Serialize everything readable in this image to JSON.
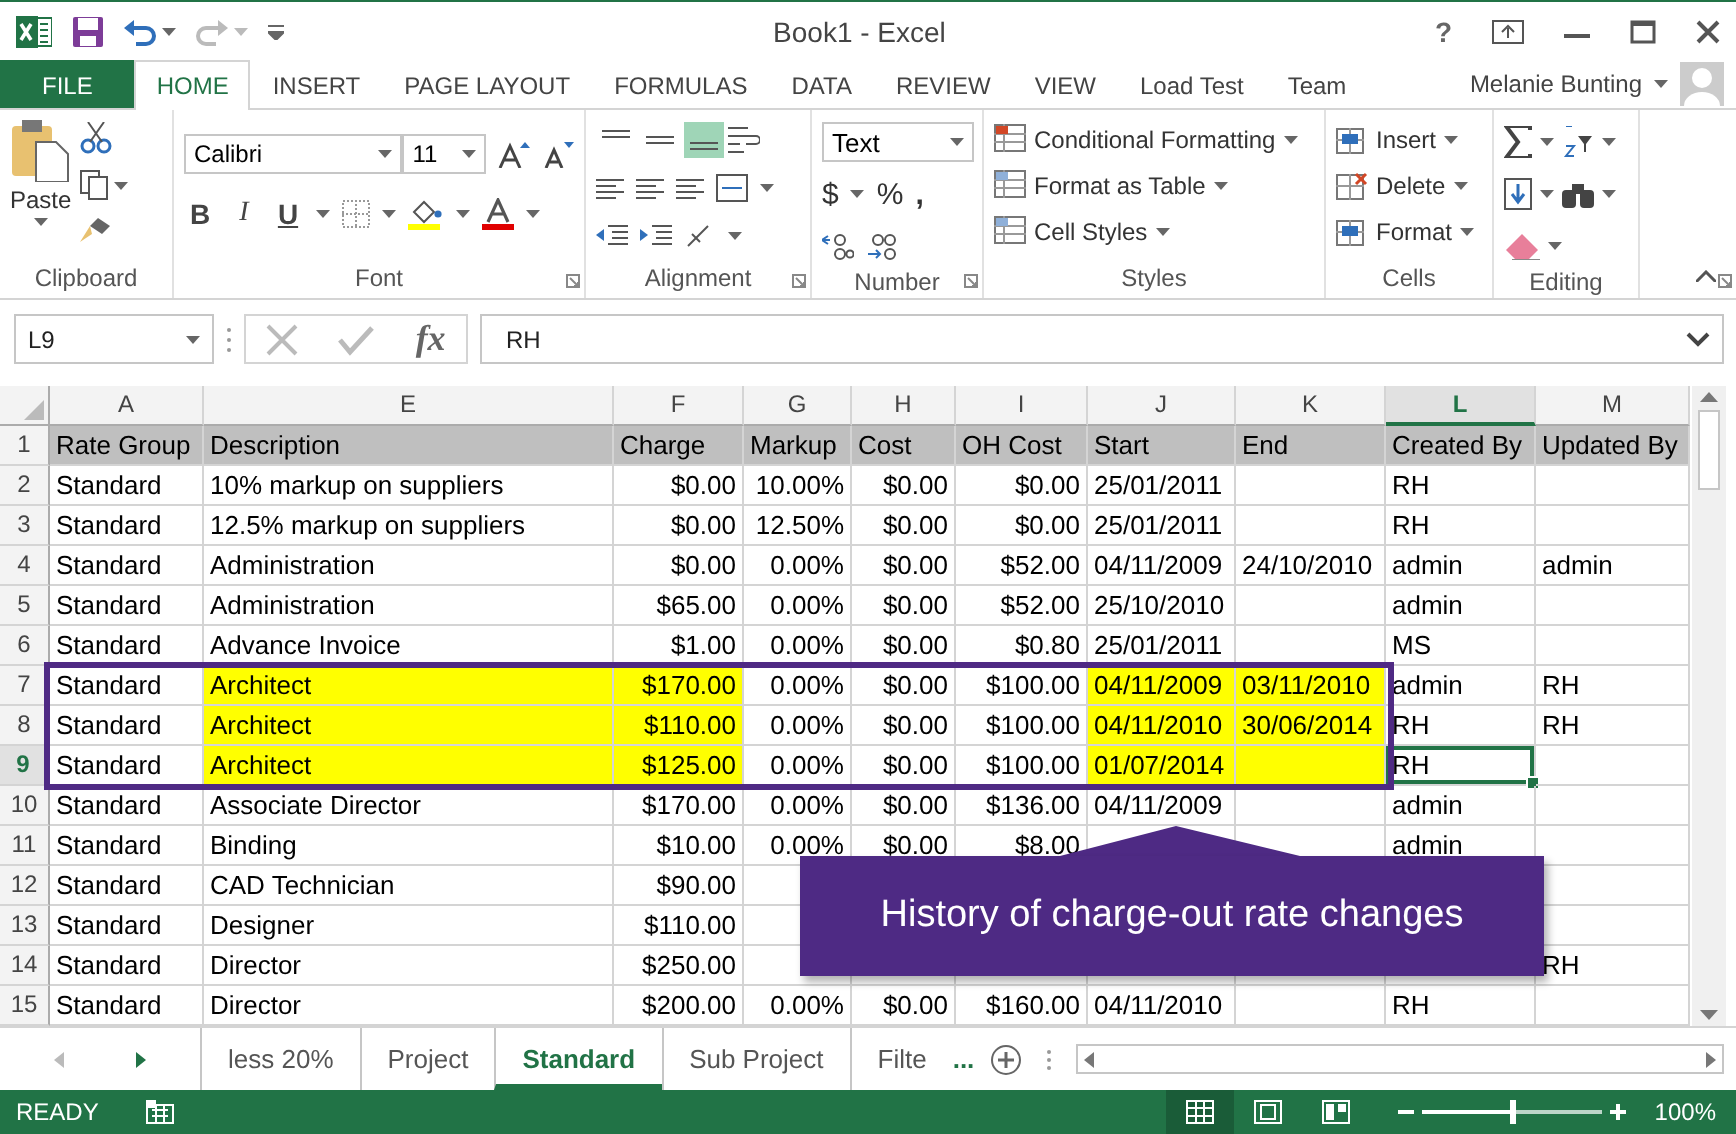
{
  "title_bar": {
    "title": "Book1 - Excel",
    "help": "?"
  },
  "ribbon_tabs": [
    {
      "label": "FILE",
      "kind": "file",
      "selected": false
    },
    {
      "label": "HOME",
      "kind": "tab",
      "selected": true
    },
    {
      "label": "INSERT",
      "kind": "tab",
      "selected": false
    },
    {
      "label": "PAGE LAYOUT",
      "kind": "tab",
      "selected": false
    },
    {
      "label": "FORMULAS",
      "kind": "tab",
      "selected": false
    },
    {
      "label": "DATA",
      "kind": "tab",
      "selected": false
    },
    {
      "label": "REVIEW",
      "kind": "tab",
      "selected": false
    },
    {
      "label": "VIEW",
      "kind": "tab",
      "selected": false
    },
    {
      "label": "Load Test",
      "kind": "tab",
      "selected": false
    },
    {
      "label": "Team",
      "kind": "tab",
      "selected": false
    }
  ],
  "user": {
    "name": "Melanie Bunting"
  },
  "ribbon": {
    "clipboard": {
      "paste": "Paste",
      "label": "Clipboard"
    },
    "font": {
      "font_name": "Calibri",
      "font_size": "11",
      "bold": "B",
      "italic": "I",
      "underline": "U",
      "label": "Font"
    },
    "alignment": {
      "vertical_buttons": [
        {
          "selected": false
        },
        {
          "selected": false
        },
        {
          "selected": true
        }
      ],
      "label": "Alignment"
    },
    "number": {
      "format": "Text",
      "currency": "$",
      "percent": "%",
      "comma": ",",
      "label": "Number"
    },
    "styles": {
      "buttons": [
        "Conditional Formatting",
        "Format as Table",
        "Cell Styles"
      ],
      "label": "Styles"
    },
    "cells": {
      "buttons": [
        "Insert",
        "Delete",
        "Format"
      ],
      "label": "Cells"
    },
    "editing": {
      "label": "Editing"
    }
  },
  "formula_bar": {
    "name_box": "L9",
    "function_label": "fx",
    "formula": "RH"
  },
  "sheet": {
    "columns": [
      {
        "letter": "A",
        "kind": "text",
        "highlight": false,
        "selected": false
      },
      {
        "letter": "E",
        "kind": "text",
        "highlight": true,
        "selected": false
      },
      {
        "letter": "F",
        "kind": "number",
        "highlight": true,
        "selected": false
      },
      {
        "letter": "G",
        "kind": "number",
        "highlight": false,
        "selected": false
      },
      {
        "letter": "H",
        "kind": "number",
        "highlight": false,
        "selected": false
      },
      {
        "letter": "I",
        "kind": "number",
        "highlight": false,
        "selected": false
      },
      {
        "letter": "J",
        "kind": "text",
        "highlight": true,
        "selected": false
      },
      {
        "letter": "K",
        "kind": "text",
        "highlight": true,
        "selected": false
      },
      {
        "letter": "L",
        "kind": "text",
        "highlight": false,
        "selected": true
      },
      {
        "letter": "M",
        "kind": "text",
        "highlight": false,
        "selected": false
      }
    ],
    "rows": [
      {
        "number": "1",
        "kind": "heading",
        "highlight": false,
        "selected": false,
        "cells": [
          "Rate Group",
          "Description",
          "Charge",
          "Markup",
          "Cost",
          "OH Cost",
          "Start",
          "End",
          "Created By",
          "Updated By"
        ]
      },
      {
        "number": "2",
        "kind": "data",
        "highlight": false,
        "selected": false,
        "cells": [
          "Standard",
          "10% markup on suppliers",
          "$0.00",
          "10.00%",
          "$0.00",
          "$0.00",
          "25/01/2011",
          null,
          "RH",
          null
        ]
      },
      {
        "number": "3",
        "kind": "data",
        "highlight": false,
        "selected": false,
        "cells": [
          "Standard",
          "12.5% markup on suppliers",
          "$0.00",
          "12.50%",
          "$0.00",
          "$0.00",
          "25/01/2011",
          null,
          "RH",
          null
        ]
      },
      {
        "number": "4",
        "kind": "data",
        "highlight": false,
        "selected": false,
        "cells": [
          "Standard",
          "Administration",
          "$0.00",
          "0.00%",
          "$0.00",
          "$52.00",
          "04/11/2009",
          "24/10/2010",
          "admin",
          "admin"
        ]
      },
      {
        "number": "5",
        "kind": "data",
        "highlight": false,
        "selected": false,
        "cells": [
          "Standard",
          "Administration",
          "$65.00",
          "0.00%",
          "$0.00",
          "$52.00",
          "25/10/2010",
          null,
          "admin",
          null
        ]
      },
      {
        "number": "6",
        "kind": "data",
        "highlight": false,
        "selected": false,
        "cells": [
          "Standard",
          "Advance Invoice",
          "$1.00",
          "0.00%",
          "$0.00",
          "$0.80",
          "25/01/2011",
          null,
          "MS",
          null
        ]
      },
      {
        "number": "7",
        "kind": "data",
        "highlight": true,
        "selected": false,
        "cells": [
          "Standard",
          "Architect",
          "$170.00",
          "0.00%",
          "$0.00",
          "$100.00",
          "04/11/2009",
          "03/11/2010",
          "admin",
          "RH"
        ]
      },
      {
        "number": "8",
        "kind": "data",
        "highlight": true,
        "selected": false,
        "cells": [
          "Standard",
          "Architect",
          "$110.00",
          "0.00%",
          "$0.00",
          "$100.00",
          "04/11/2010",
          "30/06/2014",
          "RH",
          "RH"
        ]
      },
      {
        "number": "9",
        "kind": "data",
        "highlight": true,
        "selected": true,
        "cells": [
          "Standard",
          "Architect",
          "$125.00",
          "0.00%",
          "$0.00",
          "$100.00",
          "01/07/2014",
          null,
          "RH",
          null
        ]
      },
      {
        "number": "10",
        "kind": "data",
        "highlight": false,
        "selected": false,
        "cells": [
          "Standard",
          "Associate Director",
          "$170.00",
          "0.00%",
          "$0.00",
          "$136.00",
          "04/11/2009",
          null,
          "admin",
          null
        ]
      },
      {
        "number": "11",
        "kind": "data",
        "highlight": false,
        "selected": false,
        "cells": [
          "Standard",
          "Binding",
          "$10.00",
          "0.00%",
          "$0.00",
          "$8.00",
          null,
          null,
          "admin",
          null
        ]
      },
      {
        "number": "12",
        "kind": "data",
        "highlight": false,
        "selected": false,
        "cells": [
          "Standard",
          "CAD Technician",
          "$90.00",
          null,
          null,
          null,
          null,
          null,
          null,
          null
        ]
      },
      {
        "number": "13",
        "kind": "data",
        "highlight": false,
        "selected": false,
        "cells": [
          "Standard",
          "Designer",
          "$110.00",
          null,
          null,
          null,
          null,
          null,
          null,
          null
        ]
      },
      {
        "number": "14",
        "kind": "data",
        "highlight": false,
        "selected": false,
        "cells": [
          "Standard",
          "Director",
          "$250.00",
          null,
          null,
          null,
          null,
          null,
          null,
          "RH"
        ]
      },
      {
        "number": "15",
        "kind": "data",
        "highlight": false,
        "selected": false,
        "cells": [
          "Standard",
          "Director",
          "$200.00",
          "0.00%",
          "$0.00",
          "$160.00",
          "04/11/2010",
          null,
          "RH",
          null
        ]
      }
    ]
  },
  "callout": {
    "text": "History of charge-out rate changes"
  },
  "sheet_tabs": [
    {
      "label": "less 20%",
      "selected": false
    },
    {
      "label": "Project",
      "selected": false
    },
    {
      "label": "Standard",
      "selected": true
    },
    {
      "label": "Sub Project",
      "selected": false
    },
    {
      "label": "Filte",
      "selected": false
    }
  ],
  "more_tabs": "...",
  "status_bar": {
    "status": "READY",
    "zoom_slider": {
      "level": 0.5
    },
    "zoom": "100%"
  }
}
